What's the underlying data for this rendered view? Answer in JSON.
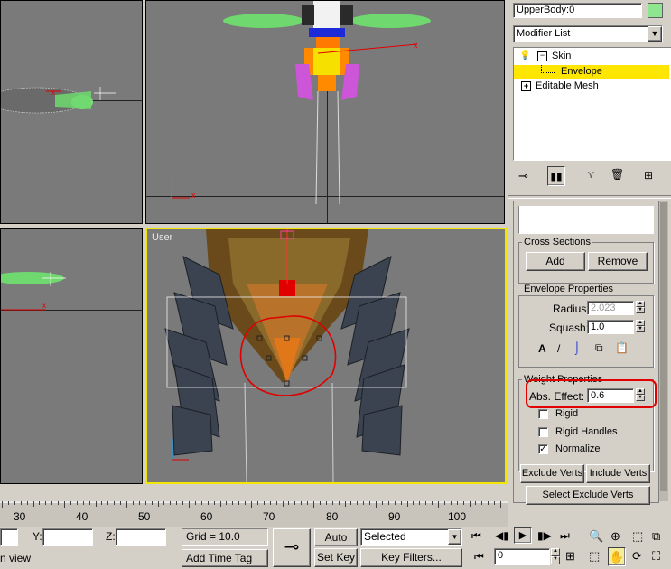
{
  "object_name": "UpperBody:0",
  "modifier_list_label": "Modifier List",
  "modifier_stack": [
    {
      "label": "Skin",
      "expander": "⊟"
    },
    {
      "label": "Envelope",
      "selected": true
    },
    {
      "label": "Editable Mesh",
      "expander": "+"
    }
  ],
  "viewport_user_label": "User",
  "cross_sections": {
    "title": "Cross Sections",
    "add": "Add",
    "remove": "Remove"
  },
  "envelope_properties": {
    "title": "Envelope Properties",
    "radius_label": "Radius:",
    "radius_value": "2.023",
    "squash_label": "Squash:",
    "squash_value": "1.0"
  },
  "weight_properties": {
    "title": "Weight Properties",
    "abs_effect_label": "Abs. Effect:",
    "abs_effect_value": "0.6",
    "rigid_label": "Rigid",
    "rigid_handles_label": "Rigid Handles",
    "normalize_label": "Normalize",
    "rigid_checked": false,
    "rigid_handles_checked": false,
    "normalize_checked": true
  },
  "exclude_verts": "Exclude Verts",
  "include_verts": "Include Verts",
  "select_exclude_verts": "Select Exclude Verts",
  "timeline_ticks": [
    "30",
    "40",
    "50",
    "60",
    "70",
    "80",
    "90",
    "100"
  ],
  "status": {
    "y_label": "Y:",
    "z_label": "Z:",
    "grid_text": "Grid = 10.0",
    "add_time_tag": "Add Time Tag",
    "auto_key": "Auto Key",
    "set_key": "Set Key",
    "key_mode_value": "Selected",
    "key_filters": "Key Filters...",
    "frame_value": "0",
    "prompt_text": "n view"
  },
  "colors": {
    "viewport_bg": "#7a7a7a",
    "active_border": "#f2e600",
    "selection_highlight": "#ffe600",
    "annotation_red": "#e00000",
    "object_color_swatch": "#8ee68e"
  }
}
